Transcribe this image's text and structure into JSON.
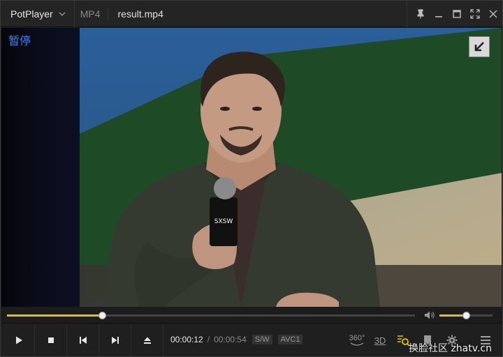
{
  "titlebar": {
    "app_name": "PotPlayer",
    "format": "MP4",
    "filename": "result.mp4"
  },
  "osd": {
    "status_text": "暂停"
  },
  "playback": {
    "current_time": "00:00:12",
    "separator": "/",
    "duration": "00:00:54",
    "subtitle_tag": "S/W",
    "codec_tag": "AVC1",
    "progress_fraction": 0.233,
    "volume_fraction": 0.5
  },
  "right_controls": {
    "vr_label": "360°",
    "stereo_label": "3D"
  },
  "watermark": {
    "text": "换脸社区 zhatv.cn"
  },
  "microphone": {
    "brand_text": "SXSW"
  },
  "colors": {
    "accent": "#e6c200",
    "osd_text": "#4b7fe8",
    "titlebar_bg": "#242424",
    "controlbar_bg": "#1f1f1f"
  },
  "icons": {
    "brand_menu": "chevron-down-icon",
    "pin": "pin-icon",
    "minimize": "minimize-icon",
    "maximize": "maximize-icon",
    "fullscreen": "fullscreen-icon",
    "close": "close-icon",
    "corner": "arrow-down-left-icon",
    "volume": "speaker-icon",
    "play": "play-icon",
    "stop": "stop-icon",
    "prev": "skip-previous-icon",
    "next": "skip-next-icon",
    "eject": "eject-icon",
    "vr": "vr-360-icon",
    "stereo": "3d-icon",
    "search": "search-list-icon",
    "chapters": "bookmark-icon",
    "settings": "gear-icon",
    "menu": "hamburger-menu-icon"
  }
}
